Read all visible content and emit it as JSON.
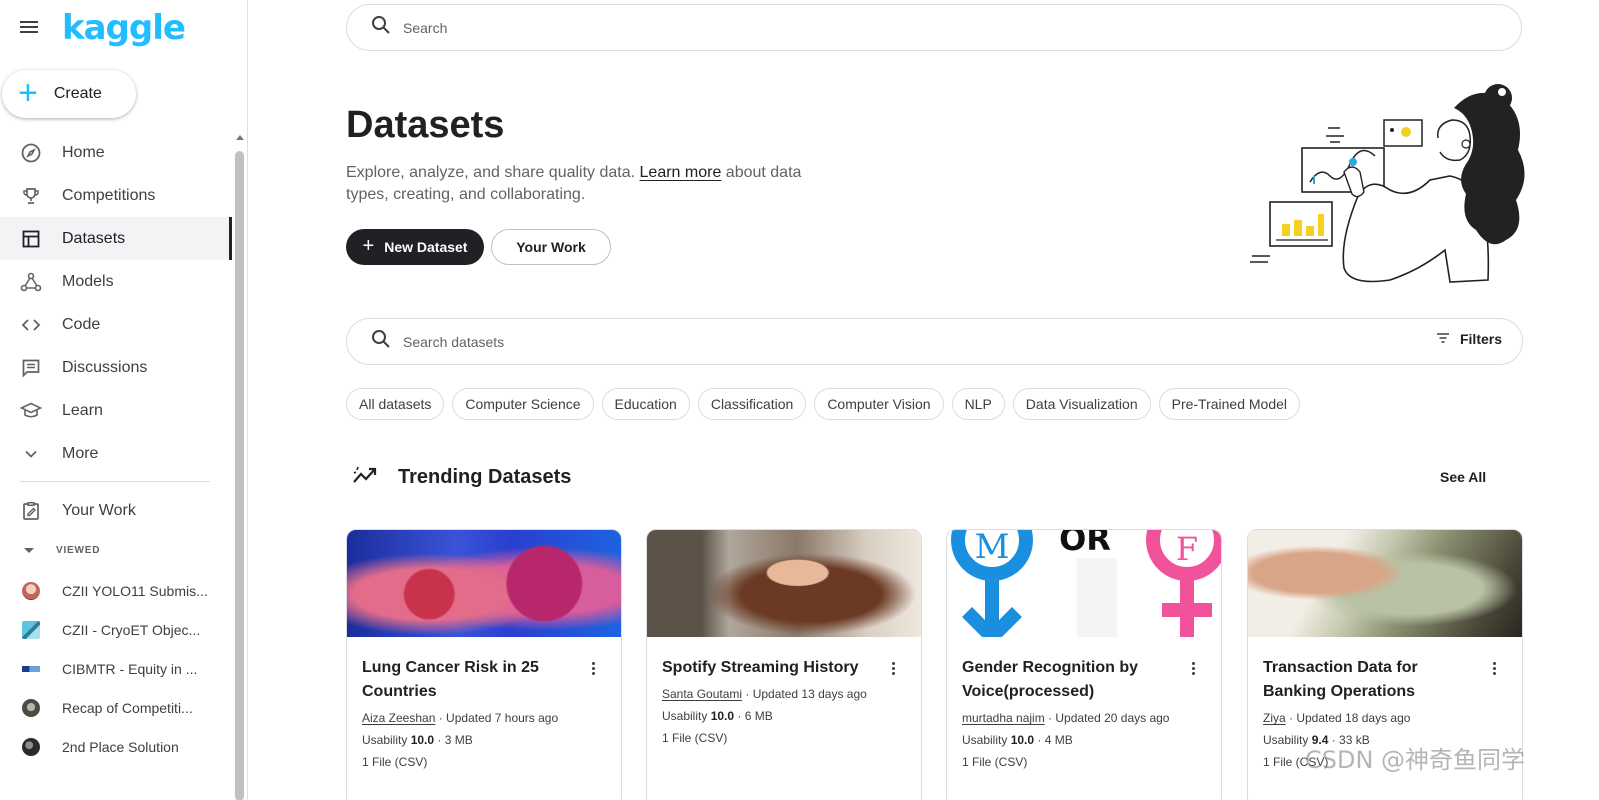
{
  "sidebar": {
    "logo": "kaggle",
    "create_label": "Create",
    "nav": [
      {
        "label": "Home",
        "icon": "compass-icon"
      },
      {
        "label": "Competitions",
        "icon": "trophy-icon"
      },
      {
        "label": "Datasets",
        "icon": "table-icon",
        "active": true
      },
      {
        "label": "Models",
        "icon": "models-icon"
      },
      {
        "label": "Code",
        "icon": "code-icon"
      },
      {
        "label": "Discussions",
        "icon": "comments-icon"
      },
      {
        "label": "Learn",
        "icon": "graduation-cap-icon"
      },
      {
        "label": "More",
        "icon": "chevron-down-icon"
      }
    ],
    "your_work": "Your Work",
    "viewed_header": "VIEWED",
    "viewed": [
      {
        "label": "CZII YOLO11 Submis..."
      },
      {
        "label": "CZII - CryoET Objec..."
      },
      {
        "label": "CIBMTR - Equity in ..."
      },
      {
        "label": "Recap of Competiti..."
      },
      {
        "label": "2nd Place Solution"
      }
    ]
  },
  "top_search": {
    "placeholder": "Search"
  },
  "hero": {
    "title": "Datasets",
    "desc_before": "Explore, analyze, and share quality data. ",
    "desc_link": "Learn more",
    "desc_after": " about data types, creating, and collaborating.",
    "new_dataset": "New Dataset",
    "your_work": "Your Work"
  },
  "dataset_search": {
    "placeholder": "Search datasets",
    "filters": "Filters"
  },
  "chips": [
    "All datasets",
    "Computer Science",
    "Education",
    "Classification",
    "Computer Vision",
    "NLP",
    "Data Visualization",
    "Pre-Trained Model"
  ],
  "trending": {
    "title": "Trending Datasets",
    "see_all": "See All",
    "cards": [
      {
        "title": "Lung Cancer Risk in 25 Countries",
        "author": "Aiza Zeeshan",
        "updated": " · Updated 7 hours ago",
        "usability_label": "Usability ",
        "usability": "10.0",
        "size": " · 3 MB",
        "files": "1 File (CSV)"
      },
      {
        "title": "Spotify Streaming History",
        "author": "Santa Goutami",
        "updated": " · Updated 13 days ago",
        "usability_label": "Usability ",
        "usability": "10.0",
        "size": " · 6 MB",
        "files": "1 File (CSV)"
      },
      {
        "title": "Gender Recognition by Voice(processed)",
        "author": "murtadha najim",
        "updated": " · Updated 20 days ago",
        "usability_label": "Usability ",
        "usability": "10.0",
        "size": " · 4 MB",
        "files": "1 File (CSV)"
      },
      {
        "title": "Transaction Data for Banking Operations",
        "author": "Ziya",
        "updated": " · Updated 18 days ago",
        "usability_label": "Usability ",
        "usability": "9.4",
        "size": " · 33 kB",
        "files": "1 File (CSV)"
      }
    ]
  },
  "watermark": "CSDN @神奇鱼同学",
  "colors": {
    "brand": "#20beff",
    "dark_button": "#202124"
  }
}
